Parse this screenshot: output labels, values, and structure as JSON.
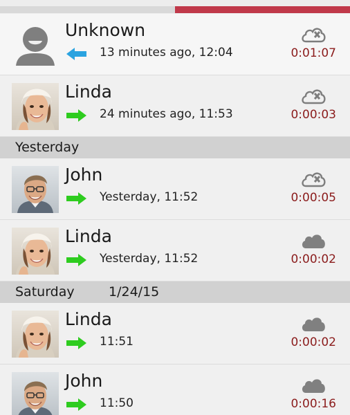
{
  "colors": {
    "tab_inactive": "#d9d9d9",
    "tab_active": "#c0394a",
    "incoming_arrow": "#2aa3e0",
    "outgoing_arrow": "#2ecc1f",
    "duration_text": "#8b1c1c",
    "cloud_fill": "#808080"
  },
  "tabs": [
    {
      "active": false
    },
    {
      "active": true
    }
  ],
  "calls": [
    {
      "avatar": "default-person-icon",
      "name": "Unknown",
      "direction": "incoming",
      "direction_icon": "arrow-left-icon",
      "when": "13 minutes ago, 12:04",
      "cloud_icon": "cloud-crossed-icon",
      "duration": "0:01:07"
    },
    {
      "avatar": "linda-photo",
      "name": "Linda",
      "direction": "outgoing",
      "direction_icon": "arrow-right-icon",
      "when": "24 minutes ago, 11:53",
      "cloud_icon": "cloud-crossed-icon",
      "duration": "0:00:03"
    },
    {
      "avatar": "john-photo",
      "name": "John",
      "direction": "outgoing",
      "direction_icon": "arrow-right-icon",
      "when": "Yesterday, 11:52",
      "cloud_icon": "cloud-crossed-icon",
      "duration": "0:00:05"
    },
    {
      "avatar": "linda-photo",
      "name": "Linda",
      "direction": "outgoing",
      "direction_icon": "arrow-right-icon",
      "when": "Yesterday, 11:52",
      "cloud_icon": "cloud-icon",
      "duration": "0:00:02"
    },
    {
      "avatar": "linda-photo",
      "name": "Linda",
      "direction": "outgoing",
      "direction_icon": "arrow-right-icon",
      "when": "11:51",
      "cloud_icon": "cloud-icon",
      "duration": "0:00:02"
    },
    {
      "avatar": "john-photo",
      "name": "John",
      "direction": "outgoing",
      "direction_icon": "arrow-right-icon",
      "when": "11:50",
      "cloud_icon": "cloud-icon",
      "duration": "0:00:16"
    }
  ],
  "sections": [
    {
      "label": "Yesterday",
      "date": ""
    },
    {
      "label": "Saturday",
      "date": "1/24/15"
    }
  ]
}
